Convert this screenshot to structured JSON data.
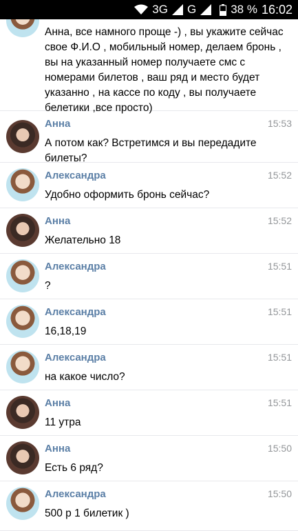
{
  "status_bar": {
    "network": "3G",
    "network2": "G",
    "battery": "38 %",
    "clock": "16:02",
    "icons": [
      "wifi-icon",
      "signal-icon",
      "signal-icon",
      "battery-icon"
    ]
  },
  "messages": [
    {
      "author": "",
      "time": "",
      "avatar": "alex",
      "text": "Анна, все намного проще -) , вы укажите сейчас свое Ф.И.О , мобильный номер, делаем бронь , вы на указанный номер получаете смс с номерами билетов , ваш ряд и место будет указанно , на кассе по коду , вы получаете белетики ,все просто)"
    },
    {
      "author": "Анна",
      "time": "15:53",
      "avatar": "anna",
      "text": "А потом как? Встретимся и вы передадите билеты?"
    },
    {
      "author": "Александра",
      "time": "15:52",
      "avatar": "alex",
      "text": "Удобно оформить бронь сейчас?"
    },
    {
      "author": "Анна",
      "time": "15:52",
      "avatar": "anna",
      "text": "Желательно 18"
    },
    {
      "author": "Александра",
      "time": "15:51",
      "avatar": "alex",
      "text": "?"
    },
    {
      "author": "Александра",
      "time": "15:51",
      "avatar": "alex",
      "text": "16,18,19"
    },
    {
      "author": "Александра",
      "time": "15:51",
      "avatar": "alex",
      "text": "на какое число?"
    },
    {
      "author": "Анна",
      "time": "15:51",
      "avatar": "anna",
      "text": "11 утра"
    },
    {
      "author": "Анна",
      "time": "15:50",
      "avatar": "anna",
      "text": "Есть 6 ряд?"
    },
    {
      "author": "Александра",
      "time": "15:50",
      "avatar": "alex",
      "text": "500 р 1 билетик )"
    }
  ]
}
